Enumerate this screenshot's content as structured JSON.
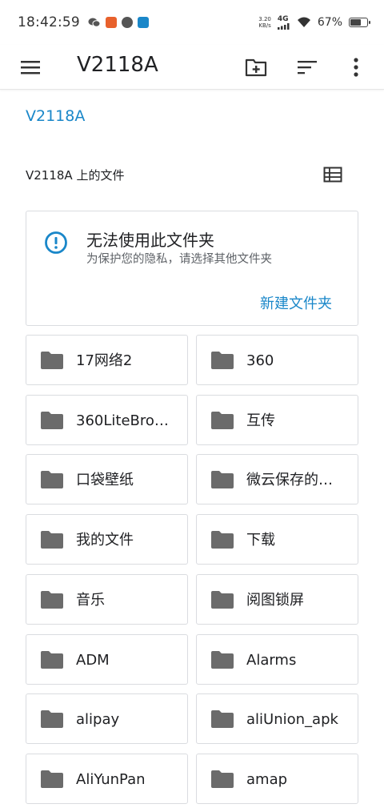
{
  "status_bar": {
    "time": "18:42:59",
    "net_speed_value": "3.20",
    "net_speed_unit": "KB/s",
    "network_type": "4G",
    "battery_text": "67%",
    "battery_level": 0.67,
    "app_icons": [
      "wechat-icon",
      "app-icon",
      "app-icon",
      "zhihu-icon"
    ]
  },
  "app_bar": {
    "title": "V2118A",
    "menu_icon": "hamburger-menu-icon",
    "new_folder_icon": "new-folder-icon",
    "sort_icon": "sort-icon",
    "more_icon": "more-vert-icon"
  },
  "breadcrumb": {
    "label": "V2118A"
  },
  "section": {
    "label": "V2118A 上的文件",
    "view_icon": "list-view-icon"
  },
  "warning": {
    "icon": "info-icon",
    "title": "无法使用此文件夹",
    "subtitle": "为保护您的隐私，请选择其他文件夹",
    "action": "新建文件夹"
  },
  "folders": [
    {
      "name": "17网络2"
    },
    {
      "name": "360"
    },
    {
      "name": "360LiteBro…"
    },
    {
      "name": "互传"
    },
    {
      "name": "口袋壁纸"
    },
    {
      "name": "微云保存的…"
    },
    {
      "name": "我的文件"
    },
    {
      "name": "下载"
    },
    {
      "name": "音乐"
    },
    {
      "name": "阅图锁屏"
    },
    {
      "name": "ADM"
    },
    {
      "name": "Alarms"
    },
    {
      "name": "alipay"
    },
    {
      "name": "aliUnion_apk"
    },
    {
      "name": "AliYunPan"
    },
    {
      "name": "amap"
    }
  ],
  "colors": {
    "accent": "#1a87c9",
    "folder_icon": "#6b6b6b",
    "border": "#dadce0"
  }
}
